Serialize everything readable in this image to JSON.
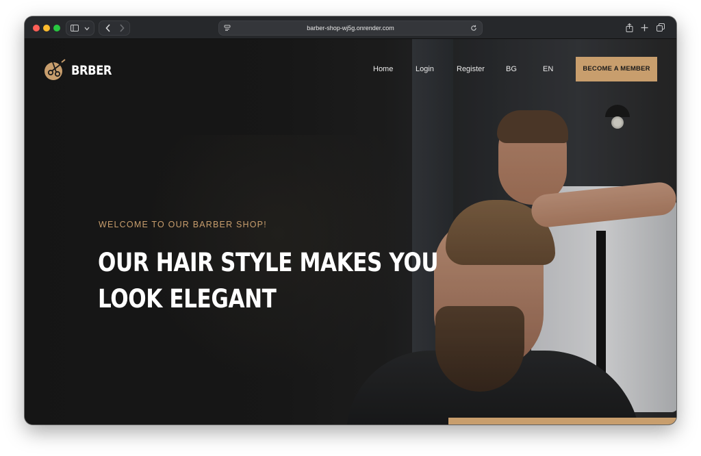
{
  "browser": {
    "url": "barber-shop-wj5g.onrender.com",
    "icons": {
      "sidebar": "sidebar-icon",
      "sidebar_menu": "chevron-down-icon",
      "back": "chevron-left-icon",
      "forward": "chevron-right-icon",
      "site": "site-settings-icon",
      "reload": "reload-icon",
      "share": "share-icon",
      "new_tab": "plus-icon",
      "tabs": "tabs-overview-icon"
    }
  },
  "site": {
    "logo_text": "BRBER",
    "nav": [
      {
        "label": "Home"
      },
      {
        "label": "Login"
      },
      {
        "label": "Register"
      },
      {
        "label": "BG"
      },
      {
        "label": "EN"
      }
    ],
    "cta_label": "BECOME A MEMBER",
    "hero": {
      "eyebrow": "WELCOME TO OUR BARBER SHOP!",
      "headline_line1": "OUR HAIR STYLE MAKES YOU",
      "headline_line2": "LOOK ELEGANT"
    }
  },
  "colors": {
    "accent": "#c89e6d",
    "background": "#1b1b1b",
    "text": "#ffffff"
  }
}
